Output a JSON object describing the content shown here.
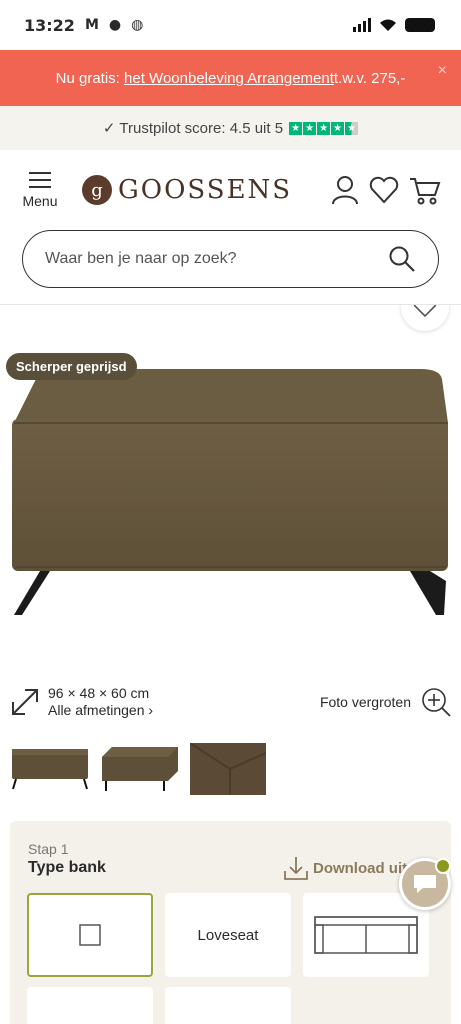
{
  "status_bar": {
    "time": "13:22"
  },
  "promo": {
    "prefix": "Nu gratis: ",
    "link": "het Woonbeleving Arrangement",
    "suffix": " t.w.v. 275,-",
    "close": "×"
  },
  "trustpilot": {
    "text": "✓ Trustpilot score: 4.5 uit 5",
    "stars": 4.5
  },
  "header": {
    "menu_label": "Menu",
    "logo_letter": "g",
    "brand": "GOOSSENS"
  },
  "search": {
    "placeholder": "Waar ben je naar op zoek?"
  },
  "product": {
    "badge": "Scherper geprijsd"
  },
  "dimensions": {
    "size": "96 × 48 × 60 cm",
    "all_link": "Alle afmetingen ›"
  },
  "zoom": {
    "label": "Foto vergroten"
  },
  "configurator": {
    "step": "Stap 1",
    "title": "Type bank",
    "download": "Download uitvoeri",
    "options": [
      "",
      "Loveseat",
      ""
    ]
  },
  "colors": {
    "promo": "#f26452",
    "accent": "#9ba53c",
    "brand": "#4a3226",
    "trust_green": "#00b67a"
  }
}
